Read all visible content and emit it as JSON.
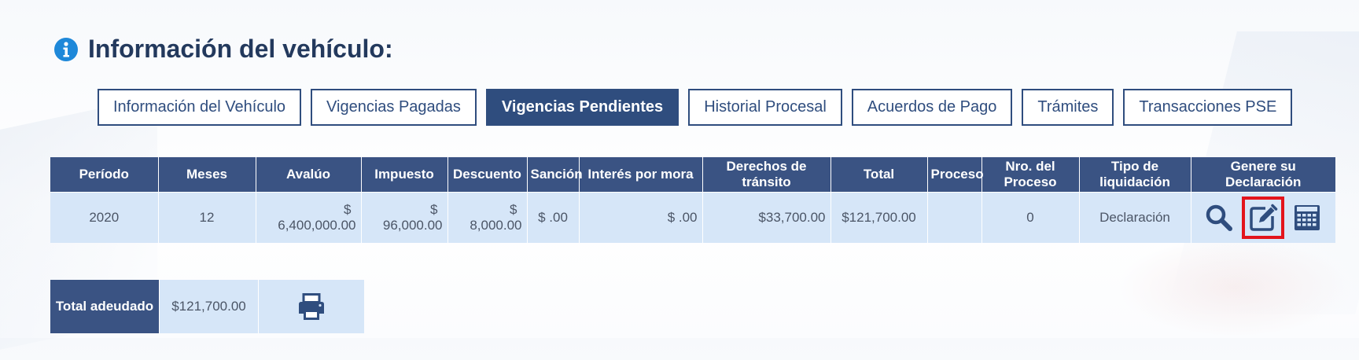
{
  "title": "Información del vehículo:",
  "tabs": [
    {
      "label": "Información del Vehículo"
    },
    {
      "label": "Vigencias Pagadas"
    },
    {
      "label": "Vigencias Pendientes"
    },
    {
      "label": "Historial Procesal"
    },
    {
      "label": "Acuerdos de Pago"
    },
    {
      "label": "Trámites"
    },
    {
      "label": "Transacciones PSE"
    }
  ],
  "active_tab": "Vigencias Pendientes",
  "table": {
    "headers": [
      "Período",
      "Meses",
      "Avalúo",
      "Impuesto",
      "Descuento",
      "Sanción",
      "Interés por mora",
      "Derechos de tránsito",
      "Total",
      "Proceso",
      "Nro. del Proceso",
      "Tipo de liquidación",
      "Genere su Declaración"
    ],
    "rows": [
      {
        "periodo": "2020",
        "meses": "12",
        "avaluo_symbol": "$",
        "avaluo_amount": "6,400,000.00",
        "impuesto_symbol": "$",
        "impuesto_amount": "96,000.00",
        "descuento_symbol": "$",
        "descuento_amount": "8,000.00",
        "sancion": "$ .00",
        "interes": "$ .00",
        "derechos": "$33,700.00",
        "total": "$121,700.00",
        "proceso": "",
        "nro_proceso": "0",
        "tipo": "Declaración",
        "actions": [
          "search-icon",
          "edit-icon",
          "calculator-icon"
        ]
      }
    ]
  },
  "totals": {
    "label": "Total adeudado",
    "value": "$121,700.00",
    "print_icon": "print-icon"
  },
  "colors": {
    "header_bg": "#3a5383",
    "row_bg": "#d6e6f8",
    "tab_border": "#2f4d7e",
    "info_icon": "#1e88d9",
    "highlight": "#e3141c"
  }
}
